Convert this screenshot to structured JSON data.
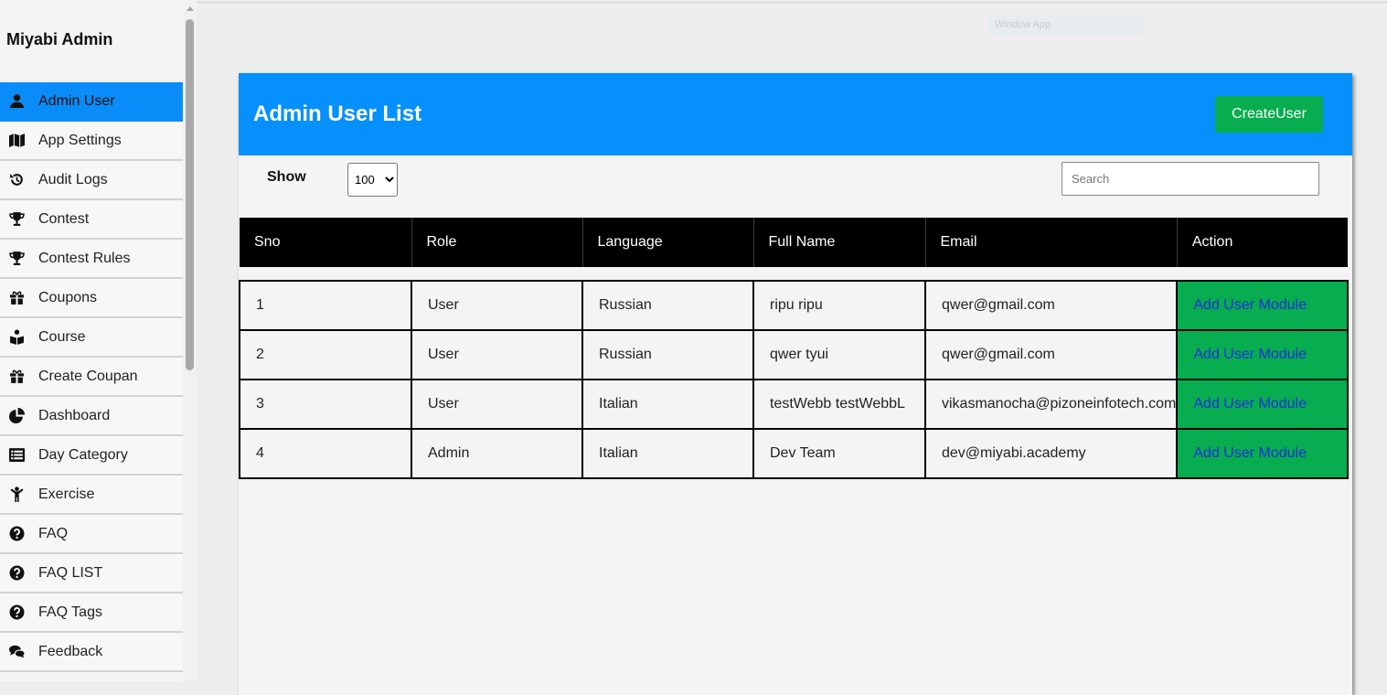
{
  "sidebar": {
    "brand": "Miyabi Admin",
    "items": [
      {
        "label": "Admin User",
        "icon": "user-icon",
        "active": true
      },
      {
        "label": "App Settings",
        "icon": "map-icon"
      },
      {
        "label": "Audit Logs",
        "icon": "history-icon"
      },
      {
        "label": "Contest",
        "icon": "trophy-icon"
      },
      {
        "label": "Contest Rules",
        "icon": "trophy-icon"
      },
      {
        "label": "Coupons",
        "icon": "gift-icon"
      },
      {
        "label": "Course",
        "icon": "book-reader-icon"
      },
      {
        "label": "Create Coupan",
        "icon": "gift-icon"
      },
      {
        "label": "Dashboard",
        "icon": "pie-chart-icon"
      },
      {
        "label": "Day Category",
        "icon": "list-icon"
      },
      {
        "label": "Exercise",
        "icon": "child-icon"
      },
      {
        "label": "FAQ",
        "icon": "question-circle-icon"
      },
      {
        "label": "FAQ LIST",
        "icon": "question-circle-icon"
      },
      {
        "label": "FAQ Tags",
        "icon": "question-circle-icon"
      },
      {
        "label": "Feedback",
        "icon": "comments-icon"
      }
    ]
  },
  "ghost_widget": {
    "label": "Window App"
  },
  "card": {
    "title": "Admin User List",
    "create_label": "CreateUser",
    "show_label": "Show",
    "page_size": "100",
    "search_placeholder": "Search"
  },
  "table": {
    "headers": [
      "Sno",
      "Role",
      "Language",
      "Full Name",
      "Email",
      "Action"
    ],
    "rows": [
      {
        "sno": "1",
        "role": "User",
        "language": "Russian",
        "full_name": "ripu ripu",
        "email": "qwer@gmail.com",
        "action": "Add User Module"
      },
      {
        "sno": "2",
        "role": "User",
        "language": "Russian",
        "full_name": "qwer tyui",
        "email": "qwer@gmail.com",
        "action": "Add User Module"
      },
      {
        "sno": "3",
        "role": "User",
        "language": "Italian",
        "full_name": "testWebb testWebbL",
        "email": "vikasmanocha@pizoneinfotech.com",
        "action": "Add User Module"
      },
      {
        "sno": "4",
        "role": "Admin",
        "language": "Italian",
        "full_name": "Dev Team",
        "email": "dev@miyabi.academy",
        "action": "Add User Module"
      }
    ]
  },
  "colors": {
    "accent": "#0690fb",
    "action_green": "#07ad4e",
    "link_blue": "#1a2fe0",
    "header_black": "#000000"
  }
}
